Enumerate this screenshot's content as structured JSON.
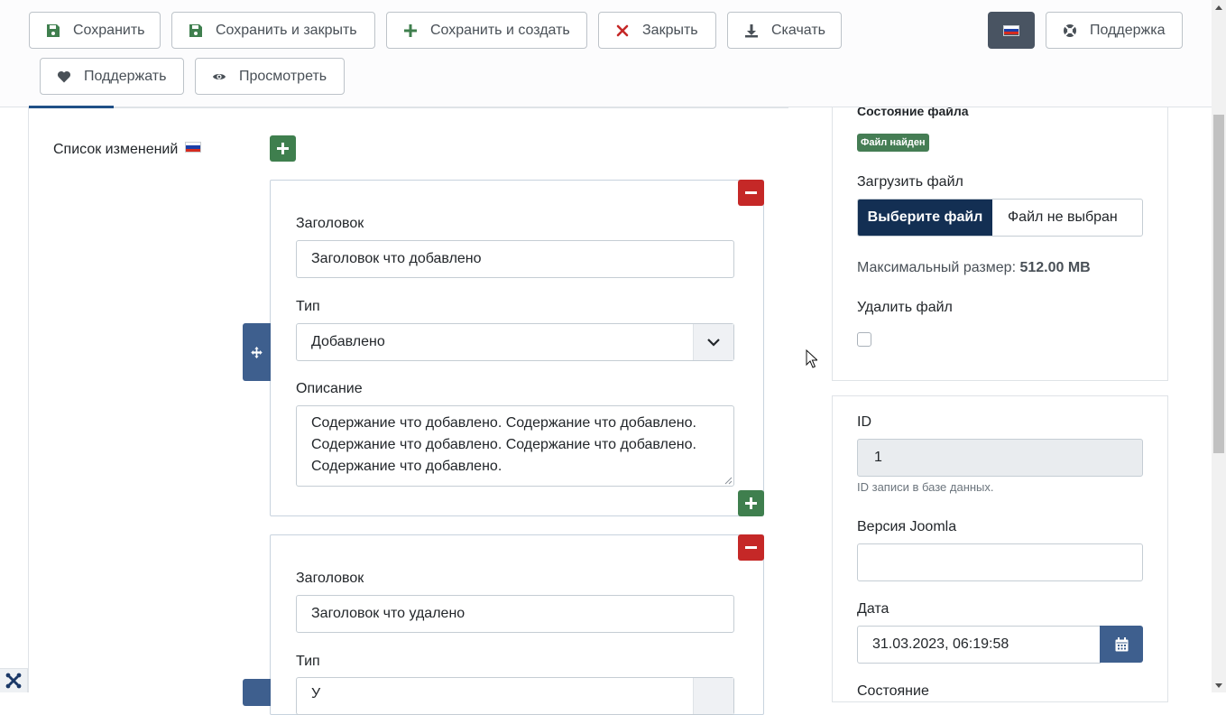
{
  "toolbar": {
    "save": "Сохранить",
    "save_close": "Сохранить и закрыть",
    "save_new": "Сохранить и создать",
    "close": "Закрыть",
    "download": "Скачать",
    "support": "Поддержка",
    "donate": "Поддержать",
    "preview": "Просмотреть"
  },
  "changelog": {
    "label": "Список изменений",
    "items": [
      {
        "title_label": "Заголовок",
        "title_value": "Заголовок что добавлено",
        "type_label": "Тип",
        "type_value": "Добавлено",
        "desc_label": "Описание",
        "desc_line1": "Содержание что добавлено. Содержание что добавлено.",
        "desc_line2": "Содержание что добавлено. Содержание что добавлено.",
        "desc_line3": "Содержание что добавлено."
      },
      {
        "title_label": "Заголовок",
        "title_value": "Заголовок что удалено",
        "type_label": "Тип",
        "type_value": "У"
      }
    ]
  },
  "file_panel": {
    "status_label": "Состояние файла",
    "status_badge": "Файл найден",
    "upload_label": "Загрузить файл",
    "choose_button": "Выберите файл",
    "no_file_text": "Файл не выбран",
    "max_size_label": "Максимальный размер:",
    "max_size_value": "512.00 MB",
    "delete_label": "Удалить файл"
  },
  "details_panel": {
    "id_label": "ID",
    "id_value": "1",
    "id_hint": "ID записи в базе данных.",
    "joomla_version_label": "Версия Joomla",
    "joomla_version_value": "",
    "date_label": "Дата",
    "date_value": "31.03.2023, 06:19:58",
    "state_label": "Состояние"
  },
  "colors": {
    "accent_dark": "#132f53",
    "add_green": "#3f7f4e",
    "remove_red": "#c52827",
    "badge_green": "#457d54"
  }
}
